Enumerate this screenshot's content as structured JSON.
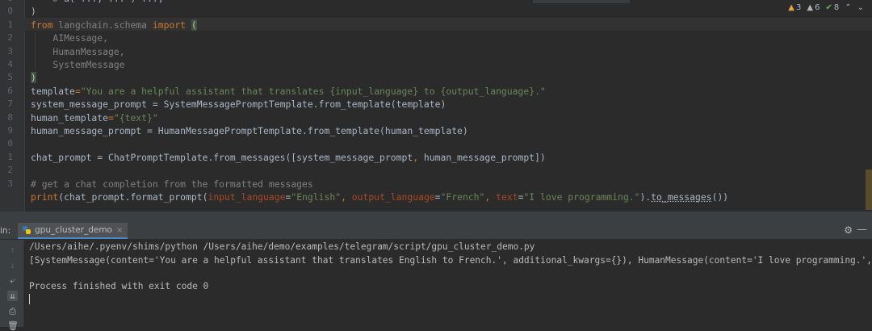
{
  "editor": {
    "line_numbers": [
      "9",
      "0",
      "1",
      "2",
      "3",
      "4",
      "5",
      "6",
      "7",
      "8",
      "9",
      "0",
      "1",
      "2",
      "3",
      ""
    ],
    "code_lines": [
      {
        "segments": [
          {
            "t": "    # a(\"..., ...\") ...,",
            "c": "ab"
          }
        ]
      },
      {
        "segments": [
          {
            "t": ")",
            "c": "ab"
          }
        ]
      },
      {
        "segments": [
          {
            "t": "from",
            "c": "kw"
          },
          {
            "t": " langchain.schema ",
            "c": "mod"
          },
          {
            "t": "import",
            "c": "kw"
          },
          {
            "t": " ",
            "c": "ab"
          },
          {
            "t": "(",
            "c": "br"
          }
        ]
      },
      {
        "segments": [
          {
            "t": "    AIMessage,",
            "c": "mod"
          }
        ]
      },
      {
        "segments": [
          {
            "t": "    HumanMessage,",
            "c": "mod"
          }
        ]
      },
      {
        "segments": [
          {
            "t": "    SystemMessage",
            "c": "mod"
          }
        ]
      },
      {
        "segments": [
          {
            "t": ")",
            "c": "br"
          }
        ]
      },
      {
        "segments": [
          {
            "t": "template",
            "c": "ab"
          },
          {
            "t": "=",
            "c": "kw"
          },
          {
            "t": "\"You are a helpful assistant that translates {input_language} to {output_language}.\"",
            "c": "st"
          }
        ]
      },
      {
        "segments": [
          {
            "t": "system_message_prompt = SystemMessagePromptTemplate.from_template(template)",
            "c": "ab"
          }
        ]
      },
      {
        "segments": [
          {
            "t": "human_template",
            "c": "ab"
          },
          {
            "t": "=",
            "c": "kw"
          },
          {
            "t": "\"{text}\"",
            "c": "st"
          }
        ]
      },
      {
        "segments": [
          {
            "t": "human_message_prompt = HumanMessagePromptTemplate.from_template(human_template)",
            "c": "ab"
          }
        ]
      },
      {
        "segments": [
          {
            "t": "",
            "c": "ab"
          }
        ]
      },
      {
        "segments": [
          {
            "t": "chat_prompt = ChatPromptTemplate.from_messages([system_message_prompt",
            "c": "ab"
          },
          {
            "t": ",",
            "c": "kw"
          },
          {
            "t": " human_message_prompt])",
            "c": "ab"
          }
        ]
      },
      {
        "segments": [
          {
            "t": "",
            "c": "ab"
          }
        ]
      },
      {
        "segments": [
          {
            "t": "# get a chat completion from the formatted messages",
            "c": "cm"
          }
        ]
      },
      {
        "segments": [
          {
            "t": "print",
            "c": "kw"
          },
          {
            "t": "(chat_prompt.format_prompt(",
            "c": "ab"
          },
          {
            "t": "input_language",
            "c": "pa"
          },
          {
            "t": "=",
            "c": "ab"
          },
          {
            "t": "\"English\"",
            "c": "st"
          },
          {
            "t": ", ",
            "c": "kw"
          },
          {
            "t": "output_language",
            "c": "pa"
          },
          {
            "t": "=",
            "c": "ab"
          },
          {
            "t": "\"French\"",
            "c": "st"
          },
          {
            "t": ", ",
            "c": "kw"
          },
          {
            "t": "text",
            "c": "pa"
          },
          {
            "t": "=",
            "c": "ab"
          },
          {
            "t": "\"I love programming.\"",
            "c": "st"
          },
          {
            "t": ").",
            "c": "ab"
          },
          {
            "t": "to_messages",
            "c": "ab ul"
          },
          {
            "t": "())",
            "c": "ab"
          }
        ]
      }
    ],
    "inspections": {
      "warnings": "3",
      "weak_warnings": "6",
      "typos": "8"
    }
  },
  "run_window": {
    "prefix": "in:",
    "tab_label": "gpu_cluster_demo",
    "tab_close": "×"
  },
  "console": {
    "lines": [
      "/Users/aihe/.pyenv/shims/python /Users/aihe/demo/examples/telegram/script/gpu_cluster_demo.py",
      "[SystemMessage(content='You are a helpful assistant that translates English to French.', additional_kwargs={}), HumanMessage(content='I love programming.', additional_kwargs={",
      "",
      "Process finished with exit code 0"
    ]
  },
  "toolbar_icons": [
    "arrow-up-icon",
    "arrow-down-icon",
    "soft-wrap-icon",
    "scroll-to-end-icon",
    "print-icon",
    "trash-icon"
  ]
}
